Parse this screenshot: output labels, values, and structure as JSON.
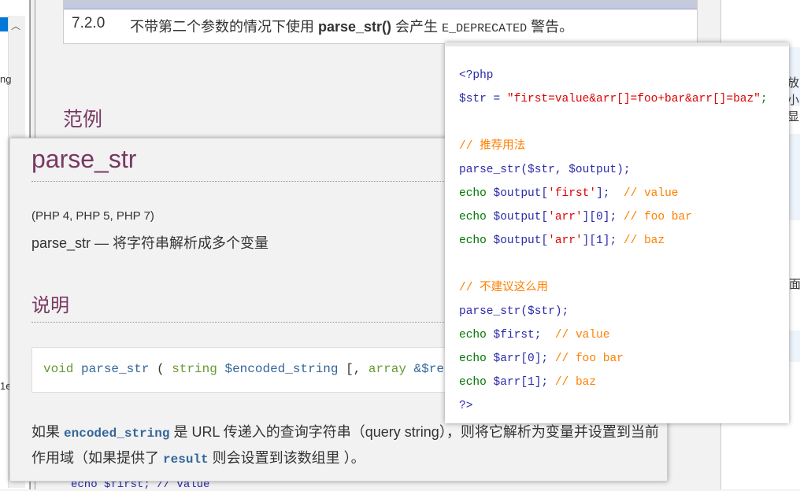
{
  "left_window": {
    "fragments": [
      "ng",
      "1e"
    ]
  },
  "changelog": {
    "version": "7.2.0",
    "desc_pre": "不带第二个参数的情况下使用 ",
    "desc_fn": "parse_str()",
    "desc_mid": " 会产生 ",
    "desc_const": "E_DEPRECATED",
    "desc_post": " 警告。"
  },
  "examples_heading": "范例",
  "right_fragments": [
    "放",
    "小显",
    "面"
  ],
  "main": {
    "title": "parse_str",
    "versions": "(PHP 4, PHP 5, PHP 7)",
    "refpurpose": "parse_str — 将字符串解析成多个变量",
    "description_heading": "说明",
    "signature": {
      "return_type": "void",
      "name": "parse_str",
      "open": " ( ",
      "type1": "string",
      "param1": "$encoded_string",
      "opt": " [, ",
      "type2": "array",
      "param2": "&$result",
      "close": " ] )"
    },
    "para": {
      "t1": "如果 ",
      "c1": "encoded_string",
      "t2": " 是 URL 传递入的查询字符串（query string），则将它解析为变量并设置到当前作用域（如果提供了 ",
      "c2": "result",
      "t3": " 则会设置到该数组里 ）。"
    }
  },
  "code_popup": {
    "lines": [
      [
        {
          "t": "<?php",
          "k": "p"
        }
      ],
      [
        {
          "t": "$str",
          "k": "v"
        },
        {
          "t": " = ",
          "k": "v"
        },
        {
          "t": "\"first=value&arr[]=foo+bar&arr[]=baz\"",
          "k": "s"
        },
        {
          "t": ";",
          "k": "e"
        }
      ],
      [],
      [
        {
          "t": "// 推荐用法",
          "k": "c"
        }
      ],
      [
        {
          "t": "parse_str($str, $output);",
          "k": "v"
        }
      ],
      [
        {
          "t": "echo ",
          "k": "e"
        },
        {
          "t": "$output[",
          "k": "v"
        },
        {
          "t": "'first'",
          "k": "s"
        },
        {
          "t": "];  ",
          "k": "v"
        },
        {
          "t": "// value",
          "k": "c"
        }
      ],
      [
        {
          "t": "echo ",
          "k": "e"
        },
        {
          "t": "$output[",
          "k": "v"
        },
        {
          "t": "'arr'",
          "k": "s"
        },
        {
          "t": "][0]; ",
          "k": "v"
        },
        {
          "t": "// foo bar",
          "k": "c"
        }
      ],
      [
        {
          "t": "echo ",
          "k": "e"
        },
        {
          "t": "$output[",
          "k": "v"
        },
        {
          "t": "'arr'",
          "k": "s"
        },
        {
          "t": "][1]; ",
          "k": "v"
        },
        {
          "t": "// baz",
          "k": "c"
        }
      ],
      [],
      [
        {
          "t": "// 不建议这么用",
          "k": "c"
        }
      ],
      [
        {
          "t": "parse_str($str);",
          "k": "v"
        }
      ],
      [
        {
          "t": "echo ",
          "k": "e"
        },
        {
          "t": "$first;  ",
          "k": "v"
        },
        {
          "t": "// value",
          "k": "c"
        }
      ],
      [
        {
          "t": "echo ",
          "k": "e"
        },
        {
          "t": "$arr[0]; ",
          "k": "v"
        },
        {
          "t": "// foo bar",
          "k": "c"
        }
      ],
      [
        {
          "t": "echo ",
          "k": "e"
        },
        {
          "t": "$arr[1]; ",
          "k": "v"
        },
        {
          "t": "// baz",
          "k": "c"
        }
      ],
      [
        {
          "t": "?>",
          "k": "p"
        }
      ]
    ]
  },
  "behind_code": "echo $first;  // value",
  "colors": {
    "heading": "#793862",
    "accent_blue": "#369",
    "comment": "#ff8000",
    "string": "#dd0000",
    "keyword": "#007700",
    "variable": "#2a2aaa"
  }
}
